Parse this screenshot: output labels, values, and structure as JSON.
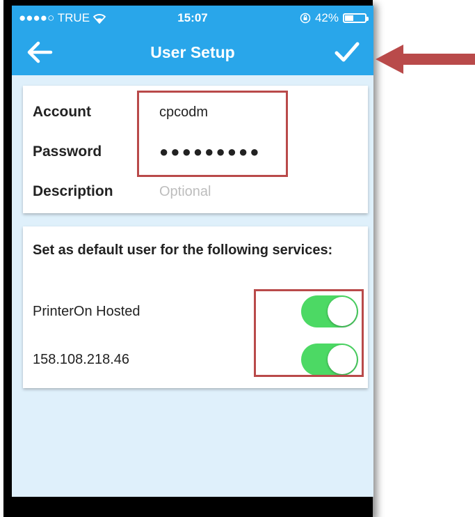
{
  "status_bar": {
    "carrier": "●●●●○ TRUE",
    "time": "15:07",
    "battery_percent": "42%"
  },
  "nav": {
    "title": "User Setup"
  },
  "account_form": {
    "account_label": "Account",
    "account_value": "cpcodm",
    "password_label": "Password",
    "password_value": "●●●●●●●●●",
    "description_label": "Description",
    "description_placeholder": "Optional"
  },
  "services": {
    "heading": "Set as default user for the following services:",
    "items": [
      {
        "label": "PrinterOn Hosted",
        "enabled": true
      },
      {
        "label": "158.108.218.46",
        "enabled": true
      }
    ]
  },
  "colors": {
    "accent": "#29a6ea",
    "screen_bg": "#dff0fb",
    "toggle_on": "#4cd964",
    "annotation": "#b94a4a"
  }
}
